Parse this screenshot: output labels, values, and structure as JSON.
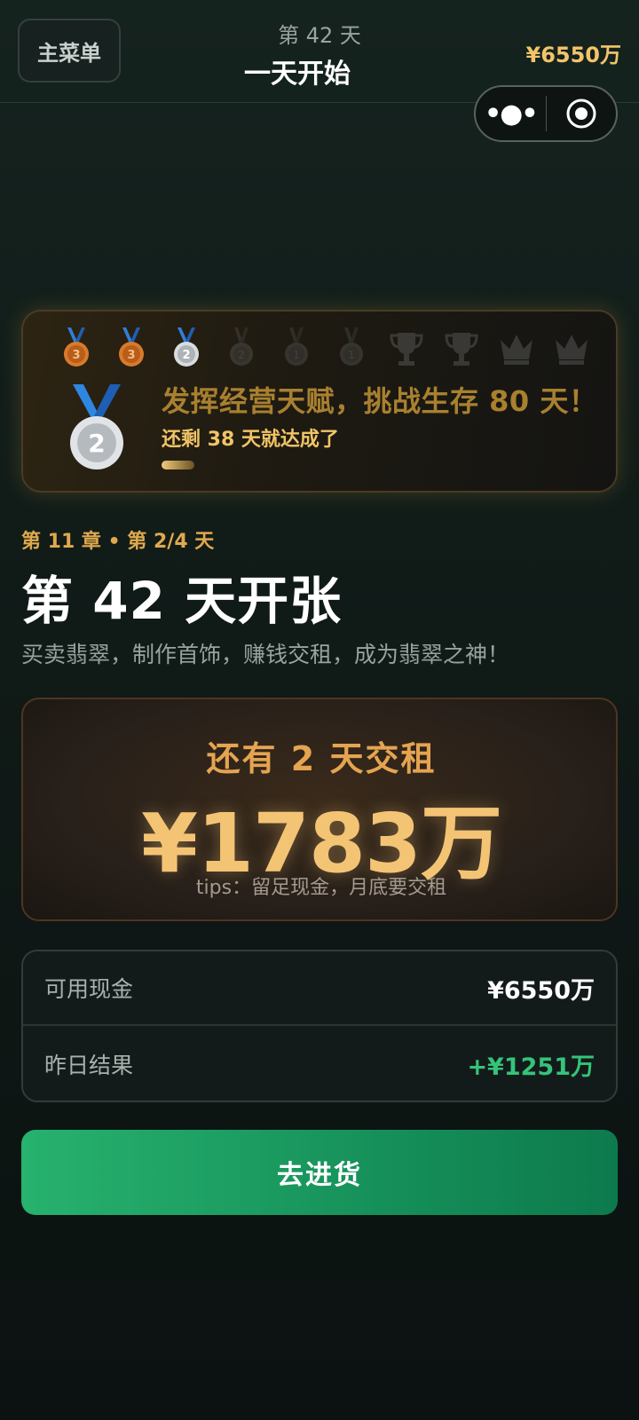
{
  "header": {
    "menu_label": "主菜单",
    "day_small": "第 42 天",
    "day_title": "一天开始",
    "cash": "¥6550万",
    "capsule_more_icon": "more-dots-icon",
    "capsule_close_icon": "target-icon"
  },
  "achievement": {
    "medals": [
      {
        "icon": "bronze-medal-icon",
        "rank": "3",
        "state": "earned"
      },
      {
        "icon": "bronze-medal-icon",
        "rank": "3",
        "state": "earned"
      },
      {
        "icon": "silver-medal-icon",
        "rank": "2",
        "state": "earned"
      },
      {
        "icon": "silver-medal-icon",
        "rank": "2",
        "state": "locked"
      },
      {
        "icon": "gold-medal-icon",
        "rank": "1",
        "state": "locked"
      },
      {
        "icon": "gold-medal-icon",
        "rank": "1",
        "state": "locked"
      },
      {
        "icon": "trophy-icon",
        "state": "locked"
      },
      {
        "icon": "trophy-icon",
        "state": "locked"
      },
      {
        "icon": "crown-icon",
        "state": "locked"
      },
      {
        "icon": "crown-icon",
        "state": "locked"
      }
    ],
    "current_medal_icon": "silver-medal-icon",
    "current_rank": "2",
    "title": "发挥经营天赋，挑战生存 80 天！",
    "subtitle": "还剩 38 天就达成了",
    "progress_fraction": 0.06,
    "colors": {
      "accent": "#f0c466"
    }
  },
  "chapter": {
    "label": "第 11 章 • 第 2/4 天",
    "headline": "第 42 天开张",
    "slogan": "买卖翡翠，制作首饰，赚钱交租，成为翡翠之神！"
  },
  "rent": {
    "label": "还有 2 天交租",
    "amount": "¥1783万",
    "tip": "tips：留足现金，月底要交租"
  },
  "stats": [
    {
      "label": "可用现金",
      "value": "¥6550万"
    },
    {
      "label": "昨日结果",
      "value": "+¥1251万"
    }
  ],
  "cta": {
    "label": "去进货",
    "color": "#27b26e"
  }
}
